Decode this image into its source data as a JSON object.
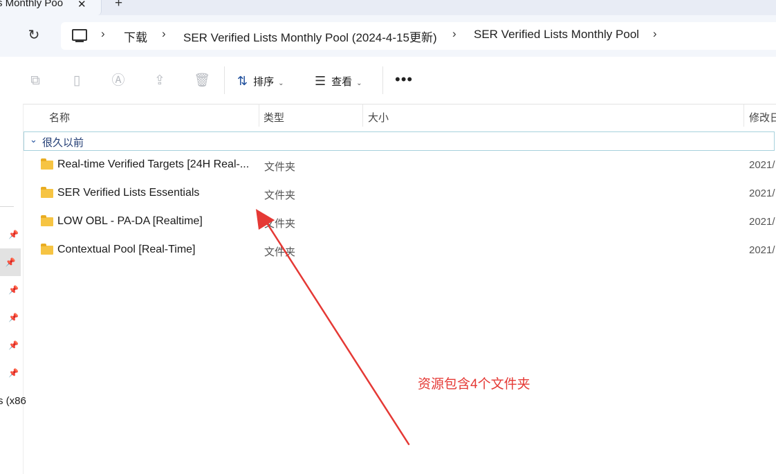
{
  "tab": {
    "title": "s Monthly Poo",
    "close": "✕",
    "new": "+"
  },
  "address": {
    "breadcrumbs": [
      "下载",
      "SER Verified Lists Monthly Pool (2024-4-15更新)",
      "SER Verified Lists Monthly Pool"
    ]
  },
  "toolbar": {
    "sort_label": "排序",
    "view_label": "查看",
    "more": "•••"
  },
  "columns": {
    "name": "名称",
    "type": "类型",
    "size": "大小",
    "modified": "修改日"
  },
  "group": {
    "title": "很久以前"
  },
  "files": [
    {
      "name": "Real-time Verified Targets [24H Real-...",
      "type": "文件夹",
      "date": "2021/"
    },
    {
      "name": "SER Verified Lists Essentials",
      "type": "文件夹",
      "date": "2021/"
    },
    {
      "name": "LOW OBL - PA-DA [Realtime]",
      "type": "文件夹",
      "date": "2021/"
    },
    {
      "name": "Contextual Pool [Real-Time]",
      "type": "文件夹",
      "date": "2021/"
    }
  ],
  "navpane": {
    "partial_label": "s (x86"
  },
  "annotation": {
    "text": "资源包含4个文件夹",
    "color": "#e53935"
  },
  "icons": [
    "refresh-icon",
    "computer-icon",
    "copy-icon",
    "paste-icon",
    "rename-icon",
    "share-icon",
    "delete-icon",
    "sort-icon",
    "view-icon",
    "pin-icon",
    "folder-icon",
    "chevron-down-icon"
  ]
}
